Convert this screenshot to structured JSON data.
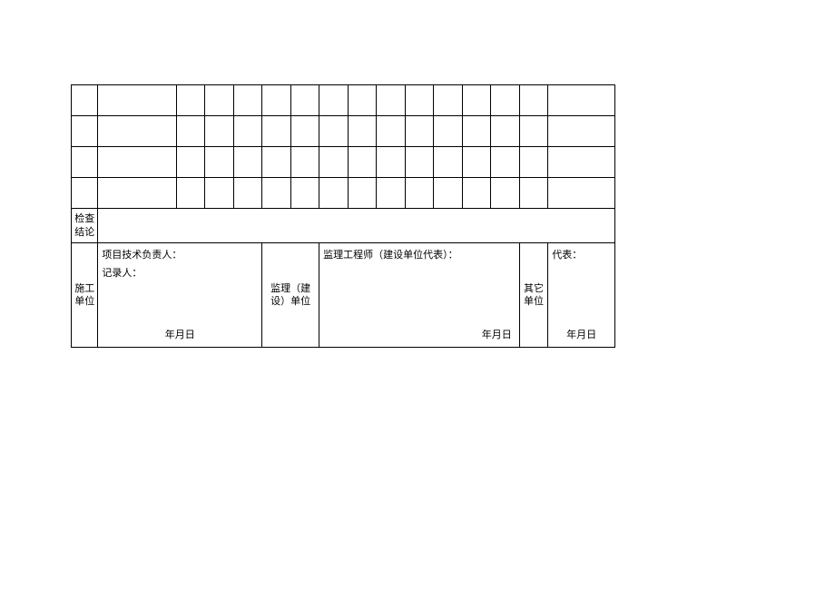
{
  "labels": {
    "conclusion": "检查结论",
    "construction_unit": "施工单位",
    "supervision_unit": "监理（建设）单位",
    "other_unit": "其它单位",
    "project_tech_leader": "项目技术负责人：",
    "recorder": "记录人：",
    "supervision_engineer": "监理工程师（建设单位代表）：",
    "representative": "代表：",
    "date": "年月日"
  }
}
